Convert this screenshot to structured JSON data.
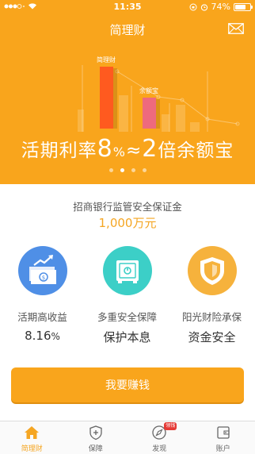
{
  "status": {
    "time": "11:35",
    "battery": "74%",
    "battery_level": 0.74
  },
  "header": {
    "title": "简理财"
  },
  "chart_data": {
    "type": "bar",
    "categories": [
      "简理财",
      "余额宝"
    ],
    "values": [
      2,
      1
    ],
    "colors": [
      "#ff5a1f",
      "#ee6a7d"
    ]
  },
  "slogan": {
    "prefix": "活期利率",
    "rate": "8",
    "rate_unit": "%",
    "approx": "≈",
    "multiple": "2",
    "suffix": "倍余额宝"
  },
  "carousel": {
    "pages": 4,
    "active_index": 1
  },
  "guarantee": {
    "text": "招商银行监管安全保证金",
    "amount": "1,000万元"
  },
  "features": [
    {
      "label": "活期高收益",
      "value": "8.16",
      "unit": "%"
    },
    {
      "label": "多重安全保障",
      "value": "保护本息",
      "unit": ""
    },
    {
      "label": "阳光财险承保",
      "value": "资金安全",
      "unit": ""
    }
  ],
  "cta": {
    "label": "我要赚钱"
  },
  "tabs": [
    {
      "label": "简理财",
      "icon": "home-icon",
      "active": true
    },
    {
      "label": "保障",
      "icon": "shield-plus-icon",
      "active": false
    },
    {
      "label": "发现",
      "icon": "compass-icon",
      "active": false,
      "badge": "领钱"
    },
    {
      "label": "账户",
      "icon": "wallet-icon",
      "active": false
    }
  ],
  "colors": {
    "accent": "#f9a51c",
    "amount": "#f5a623",
    "feature1": "#4f8fe6",
    "feature2": "#3ccfc7",
    "feature3": "#f6b23c"
  }
}
